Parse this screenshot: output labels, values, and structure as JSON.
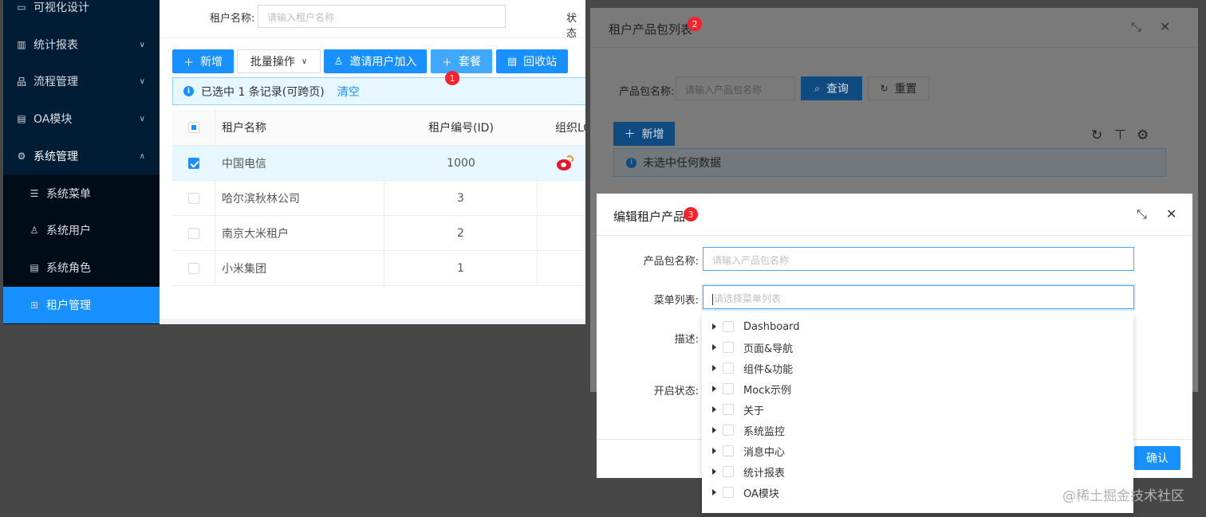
{
  "sidebar": {
    "items": [
      {
        "label": "可视化设计",
        "icon": "monitor-icon"
      },
      {
        "label": "统计报表",
        "icon": "bar-chart-icon"
      },
      {
        "label": "流程管理",
        "icon": "flow-icon"
      },
      {
        "label": "OA模块",
        "icon": "document-icon"
      },
      {
        "label": "系统管理",
        "icon": "gear-icon"
      }
    ],
    "sub_items": [
      {
        "label": "系统菜单",
        "icon": "menu-list-icon"
      },
      {
        "label": "系统用户",
        "icon": "user-icon"
      },
      {
        "label": "系统角色",
        "icon": "role-icon"
      },
      {
        "label": "租户管理",
        "icon": "grid-icon"
      }
    ]
  },
  "tenant_page": {
    "search": {
      "label": "租户名称:",
      "placeholder": "请输入租户名称",
      "status_label": "状态"
    },
    "toolbar": {
      "add": "新增",
      "batch": "批量操作",
      "invite": "邀请用户加入",
      "package": "套餐",
      "recycle": "回收站"
    },
    "alert": {
      "text": "已选中 1 条记录(可跨页)",
      "clear": "清空"
    },
    "table": {
      "columns": [
        "租户名称",
        "租户编号(ID)",
        "组织LO"
      ],
      "rows": [
        {
          "name": "中国电信",
          "id": "1000",
          "selected": true
        },
        {
          "name": "哈尔滨秋林公司",
          "id": "3",
          "selected": false
        },
        {
          "name": "南京大米租户",
          "id": "2",
          "selected": false
        },
        {
          "name": "小米集团",
          "id": "1",
          "selected": false
        }
      ]
    }
  },
  "package_modal": {
    "title": "租户产品包列表",
    "name_label": "产品包名称:",
    "name_placeholder": "请输入产品包名称",
    "query": "查询",
    "reset": "重置",
    "add": "新增",
    "alert": "未选中任何数据"
  },
  "edit_modal": {
    "title": "编辑租户产品",
    "name_label": "产品包名称:",
    "name_placeholder": "请输入产品包名称",
    "menu_label": "菜单列表:",
    "menu_placeholder": "请选择菜单列表",
    "desc_label": "描述:",
    "status_label": "开启状态:",
    "ok": "确认"
  },
  "menu_tree": [
    "Dashboard",
    "页面&导航",
    "组件&功能",
    "Mock示例",
    "关于",
    "系统监控",
    "消息中心",
    "统计报表",
    "OA模块"
  ],
  "badges": [
    "1",
    "2",
    "3"
  ],
  "watermark": "@稀土掘金技术社区",
  "colors": {
    "primary": "#1890ff",
    "sidebar": "#001529",
    "badge": "#f5222d"
  }
}
